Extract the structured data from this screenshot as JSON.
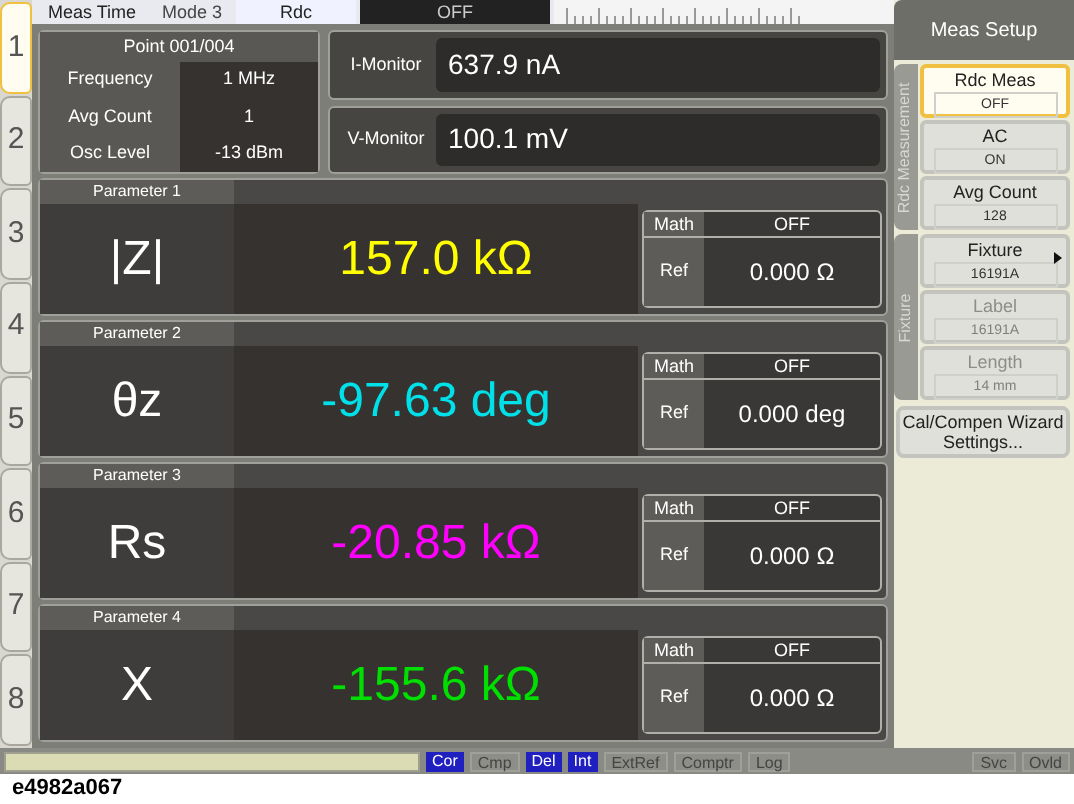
{
  "channel_tabs": [
    {
      "label": "1",
      "selected": true
    },
    {
      "label": "2",
      "selected": false
    },
    {
      "label": "3",
      "selected": false
    },
    {
      "label": "4",
      "selected": false
    },
    {
      "label": "5",
      "selected": false
    },
    {
      "label": "6",
      "selected": false
    },
    {
      "label": "7",
      "selected": false
    },
    {
      "label": "8",
      "selected": false
    }
  ],
  "top_bar": {
    "meas_time_label": "Meas Time",
    "meas_time_value": "Mode 3",
    "rdc_label": "Rdc",
    "rdc_value": "OFF"
  },
  "point": {
    "title": "Point 001/004",
    "rows": [
      {
        "label": "Frequency",
        "value": "1 MHz"
      },
      {
        "label": "Avg Count",
        "value": "1"
      },
      {
        "label": "Osc Level",
        "value": "-13 dBm"
      }
    ]
  },
  "monitors": [
    {
      "label": "I-Monitor",
      "value": "637.9 nA"
    },
    {
      "label": "V-Monitor",
      "value": "100.1 mV"
    }
  ],
  "parameters": [
    {
      "title": "Parameter 1",
      "name": "|Z|",
      "value": "157.0 kΩ",
      "color": "#ffff00",
      "math_label": "Math",
      "math_value": "OFF",
      "ref_label": "Ref",
      "ref_value": "0.000 Ω"
    },
    {
      "title": "Parameter 2",
      "name": "θz",
      "value": "-97.63 deg",
      "color": "#00e0e8",
      "math_label": "Math",
      "math_value": "OFF",
      "ref_label": "Ref",
      "ref_value": "0.000 deg"
    },
    {
      "title": "Parameter 3",
      "name": "Rs",
      "value": "-20.85 kΩ",
      "color": "#ff00ff",
      "math_label": "Math",
      "math_value": "OFF",
      "ref_label": "Ref",
      "ref_value": "0.000 Ω"
    },
    {
      "title": "Parameter 4",
      "name": "X",
      "value": "-155.6 kΩ",
      "color": "#00e000",
      "math_label": "Math",
      "math_value": "OFF",
      "ref_label": "Ref",
      "ref_value": "0.000 Ω"
    }
  ],
  "softkey_menu": {
    "title": "Meas Setup",
    "groups": [
      {
        "label": "Rdc Measurement",
        "items": [
          {
            "label": "Rdc Meas",
            "value": "OFF",
            "selected": true,
            "disabled": false,
            "submenu": false
          },
          {
            "label": "AC",
            "value": "ON",
            "selected": false,
            "disabled": false,
            "submenu": false
          },
          {
            "label": "Avg Count",
            "value": "128",
            "selected": false,
            "disabled": false,
            "submenu": false
          }
        ]
      },
      {
        "label": "Fixture",
        "items": [
          {
            "label": "Fixture",
            "value": "16191A",
            "selected": false,
            "disabled": false,
            "submenu": true
          },
          {
            "label": "Label",
            "value": "16191A",
            "selected": false,
            "disabled": true,
            "submenu": false
          },
          {
            "label": "Length",
            "value": "14 mm",
            "selected": false,
            "disabled": true,
            "submenu": false
          }
        ]
      }
    ],
    "bottom_button": "Cal/Compen Wizard Settings..."
  },
  "status_bar": {
    "indicators": [
      {
        "label": "Cor",
        "on": true
      },
      {
        "label": "Cmp",
        "on": false
      },
      {
        "label": "Del",
        "on": true
      },
      {
        "label": "Int",
        "on": true
      },
      {
        "label": "ExtRef",
        "on": false
      },
      {
        "label": "Comptr",
        "on": false
      },
      {
        "label": "Log",
        "on": false
      }
    ],
    "right_indicators": [
      {
        "label": "Svc",
        "on": false
      },
      {
        "label": "Ovld",
        "on": false
      }
    ]
  },
  "caption": "e4982a067"
}
